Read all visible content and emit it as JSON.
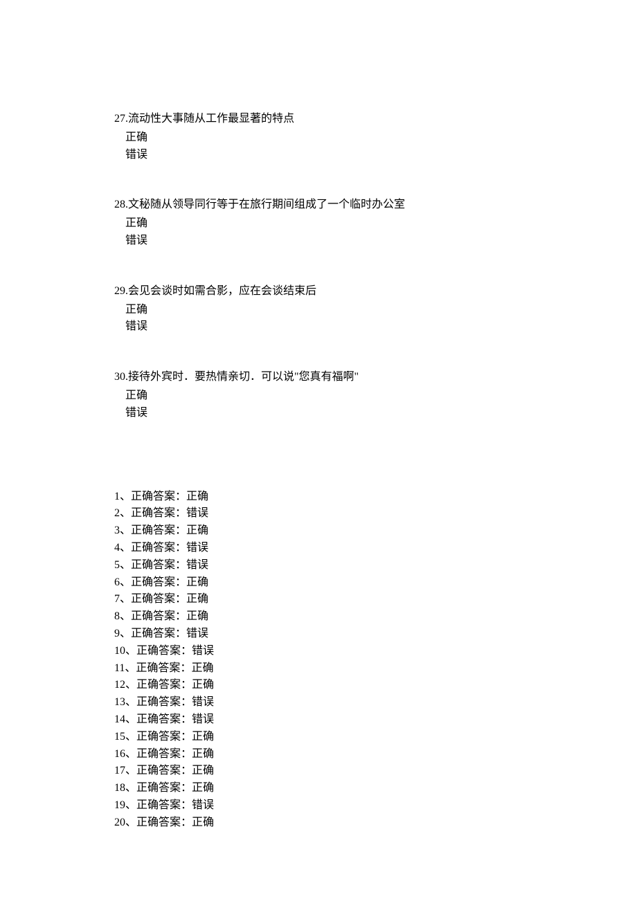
{
  "questions": [
    {
      "number": "27",
      "text": "流动性大事随从工作最显著的特点",
      "option_true": "正确",
      "option_false": "错误"
    },
    {
      "number": "28",
      "text": "文秘随从领导同行等于在旅行期间组成了一个临时办公室",
      "option_true": "正确",
      "option_false": "错误"
    },
    {
      "number": "29",
      "text": "会见会谈时如需合影，应在会谈结束后",
      "option_true": "正确",
      "option_false": "错误"
    },
    {
      "number": "30",
      "text": "接待外宾时．要热情亲切．可以说\"您真有福啊\"",
      "option_true": "正确",
      "option_false": "错误"
    }
  ],
  "answers": [
    {
      "num": "1",
      "label": "正确答案：",
      "value": "正确"
    },
    {
      "num": "2",
      "label": "正确答案：",
      "value": "错误"
    },
    {
      "num": "3",
      "label": "正确答案：",
      "value": "正确"
    },
    {
      "num": "4",
      "label": "正确答案：",
      "value": "错误"
    },
    {
      "num": "5",
      "label": "正确答案：",
      "value": "错误"
    },
    {
      "num": "6",
      "label": "正确答案：",
      "value": "正确"
    },
    {
      "num": "7",
      "label": "正确答案：",
      "value": "正确"
    },
    {
      "num": "8",
      "label": "正确答案：",
      "value": "正确"
    },
    {
      "num": "9",
      "label": "正确答案：",
      "value": "错误"
    },
    {
      "num": "10",
      "label": "正确答案：",
      "value": "错误"
    },
    {
      "num": "11",
      "label": "正确答案：",
      "value": "正确"
    },
    {
      "num": "12",
      "label": "正确答案：",
      "value": "正确"
    },
    {
      "num": "13",
      "label": "正确答案：",
      "value": "错误"
    },
    {
      "num": "14",
      "label": "正确答案：",
      "value": "错误"
    },
    {
      "num": "15",
      "label": "正确答案：",
      "value": "正确"
    },
    {
      "num": "16",
      "label": "正确答案：",
      "value": "正确"
    },
    {
      "num": "17",
      "label": "正确答案：",
      "value": "正确"
    },
    {
      "num": "18",
      "label": "正确答案：",
      "value": "正确"
    },
    {
      "num": "19",
      "label": "正确答案：",
      "value": "错误"
    },
    {
      "num": "20",
      "label": "正确答案：",
      "value": "正确"
    }
  ]
}
